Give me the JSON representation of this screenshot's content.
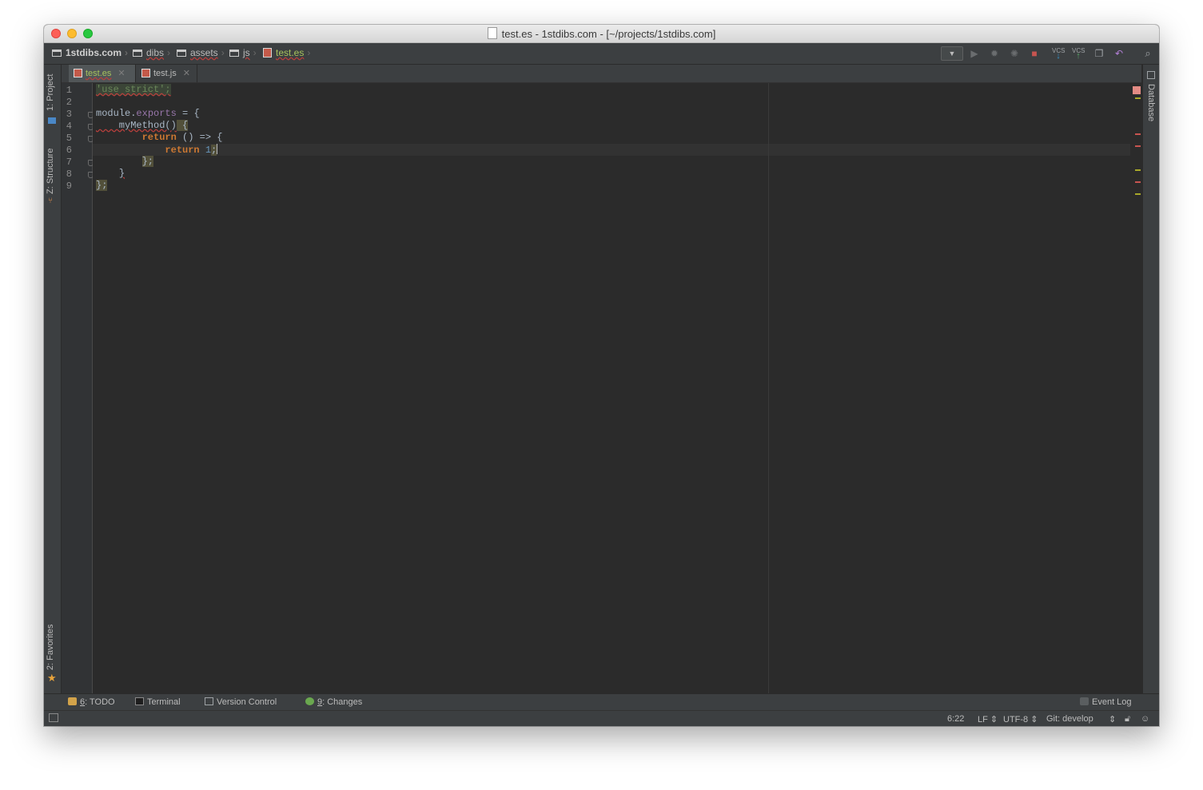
{
  "window": {
    "title": "test.es - 1stdibs.com - [~/projects/1stdibs.com]"
  },
  "navbar": {
    "breadcrumbs": [
      {
        "label": "1stdibs.com",
        "type": "folder"
      },
      {
        "label": "dibs",
        "type": "folder"
      },
      {
        "label": "assets",
        "type": "folder"
      },
      {
        "label": "js",
        "type": "folder"
      },
      {
        "label": "test.es",
        "type": "file"
      }
    ],
    "vcs_label_1": "VCS",
    "vcs_label_2": "VCS"
  },
  "left_tools": {
    "project": "1: Project",
    "structure": "Z: Structure",
    "favorites": "2: Favorites"
  },
  "right_tools": {
    "database": "Database"
  },
  "tabs": [
    {
      "label": "test.es",
      "active": true
    },
    {
      "label": "test.js",
      "active": false
    }
  ],
  "editor": {
    "line_numbers": [
      "1",
      "2",
      "3",
      "4",
      "5",
      "6",
      "7",
      "8",
      "9"
    ],
    "lines": {
      "l1": "'use strict';",
      "l3_a": "module.",
      "l3_b": "exports",
      "l3_c": " = {",
      "l4_a": "    myMethod()",
      "l4_b": " {",
      "l5_kw": "return",
      "l5_rest": " () => {",
      "l6_kw": "return",
      "l6_num": " 1",
      "l6_semi": ";",
      "l7": "};",
      "l8": "}",
      "l9": "};"
    },
    "caret_line": 6
  },
  "bottom_tools": {
    "todo_num": "6",
    "todo_label": ": TODO",
    "terminal": "Terminal",
    "version_control": "Version Control",
    "changes_num": "9",
    "changes_label": ": Changes",
    "event_log": "Event Log"
  },
  "status": {
    "position": "6:22",
    "line_sep": "LF",
    "encoding": "UTF-8",
    "git": "Git: develop"
  },
  "colors": {
    "editor_bg": "#2b2b2b",
    "keyword": "#cc7832",
    "string": "#6a8759",
    "number": "#6897bb",
    "property": "#9876aa"
  }
}
